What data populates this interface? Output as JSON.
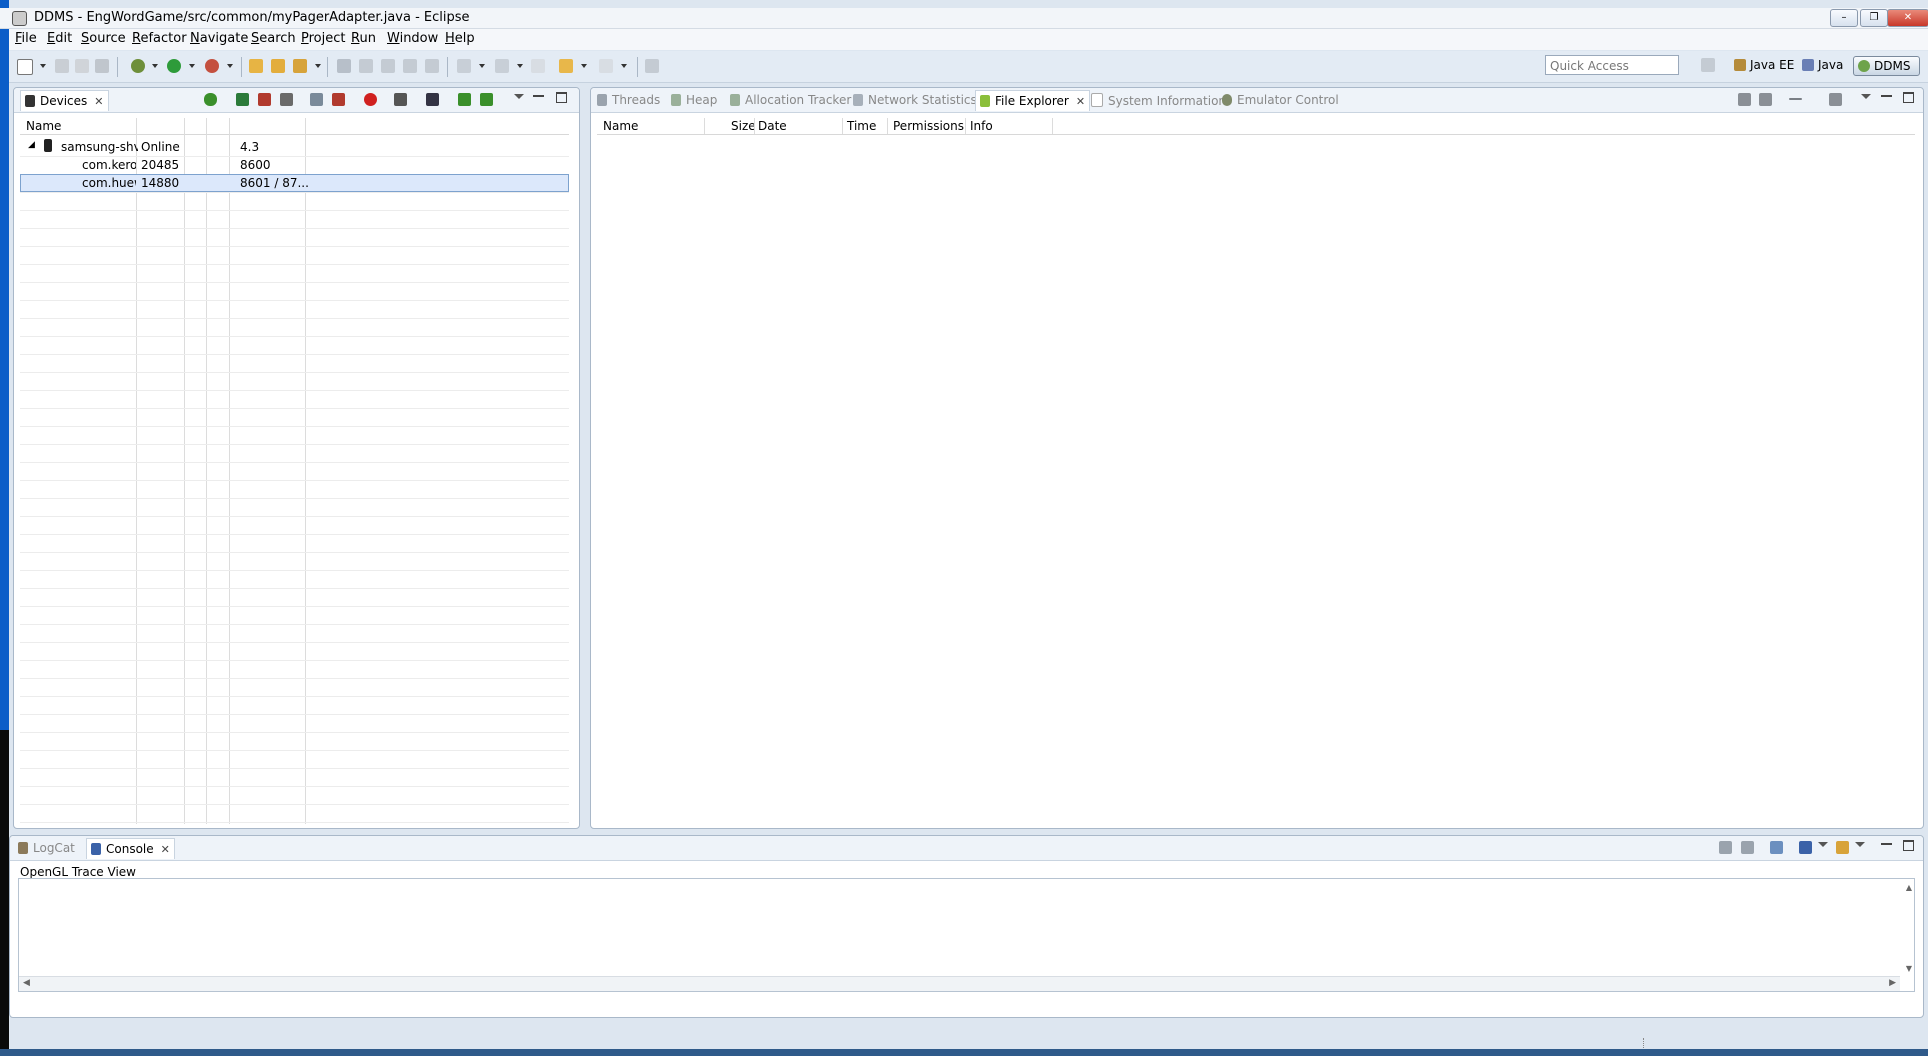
{
  "window": {
    "title": "DDMS - EngWordGame/src/common/myPagerAdapter.java - Eclipse",
    "minimize": "–",
    "restore": "❐",
    "close": "✕"
  },
  "menu": [
    "File",
    "Edit",
    "Source",
    "Refactor",
    "Navigate",
    "Search",
    "Project",
    "Run",
    "Window",
    "Help"
  ],
  "toolbar": {
    "quick_access_placeholder": "Quick Access",
    "perspectives": [
      "Java EE",
      "Java",
      "DDMS"
    ]
  },
  "devices_panel": {
    "tab_label": "Devices",
    "column_name": "Name",
    "rows": [
      {
        "name": "samsung-shv",
        "col2": "Online",
        "col5": "4.3",
        "indent": 0,
        "expanded": true
      },
      {
        "name": "com.keros",
        "col2": "20485",
        "col5": "8600",
        "indent": 1
      },
      {
        "name": "com.huew",
        "col2": "14880",
        "col5": "8601 / 87...",
        "indent": 1,
        "selected": true
      }
    ]
  },
  "right_panel": {
    "tabs": [
      {
        "label": "Threads",
        "active": false
      },
      {
        "label": "Heap",
        "active": false
      },
      {
        "label": "Allocation Tracker",
        "active": false
      },
      {
        "label": "Network Statistics",
        "active": false
      },
      {
        "label": "File Explorer",
        "active": true
      },
      {
        "label": "System Information",
        "active": false
      },
      {
        "label": "Emulator Control",
        "active": false
      }
    ],
    "columns": [
      "Name",
      "Size",
      "Date",
      "Time",
      "Permissions",
      "Info"
    ]
  },
  "bottom_panel": {
    "tabs": [
      {
        "label": "LogCat",
        "active": false
      },
      {
        "label": "Console",
        "active": true
      }
    ],
    "console_title": "OpenGL Trace View"
  },
  "colors": {
    "accent_blue": "#0b5dc8",
    "selection": "#dce8fb",
    "background": "#dde6f0"
  }
}
